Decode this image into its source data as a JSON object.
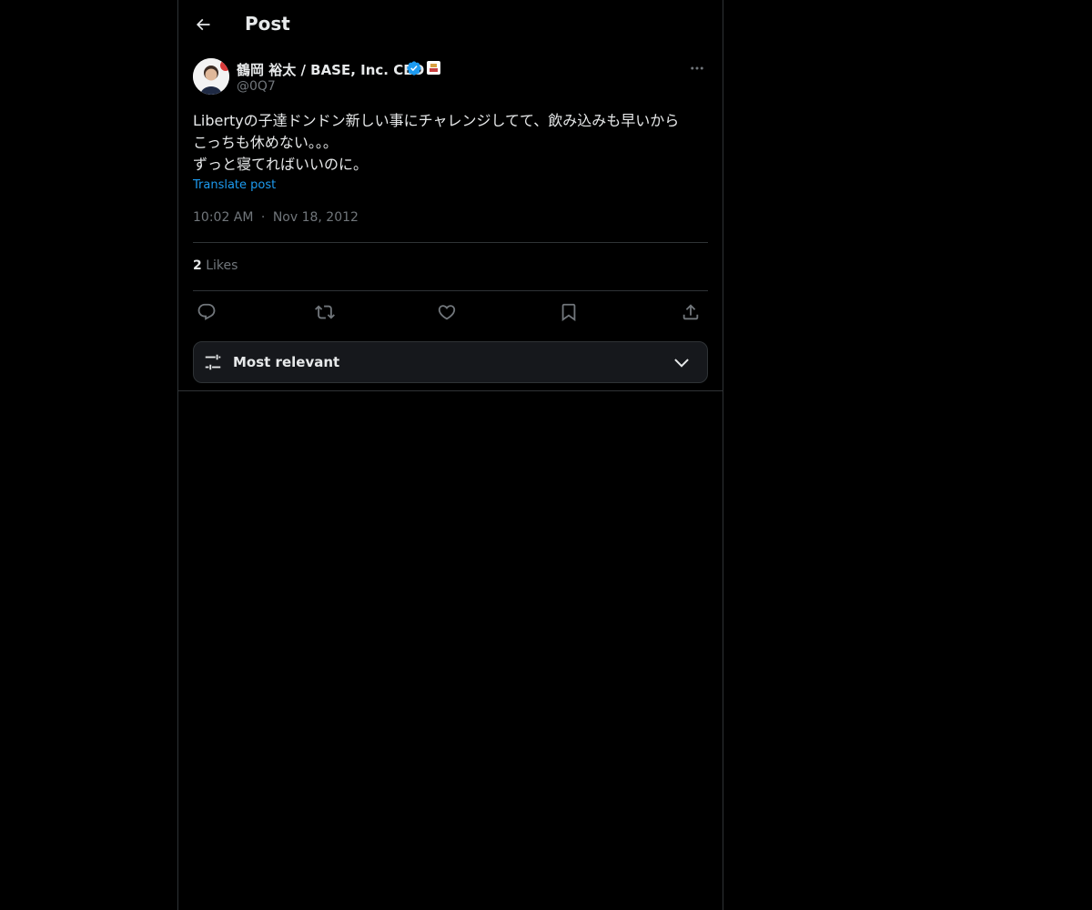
{
  "header": {
    "title": "Post",
    "back_icon": "arrow-left-icon"
  },
  "post": {
    "author": {
      "name": "鶴岡 裕太 / BASE, Inc. CEO",
      "handle": "@0Q7",
      "avatar_icon": "avatar",
      "verified_icon": "verified-badge-icon",
      "affiliate_icon": "affiliate-badge-icon"
    },
    "more_icon": "more-dots-icon",
    "text": "Libertyの子達ドンドン新しい事にチャレンジしてて、飲み込みも早いから\nこっちも休めない。。。\nずっと寝てればいいのに。",
    "translate_label": "Translate post",
    "time": "10:02 AM",
    "separator": "·",
    "date": "Nov 18, 2012",
    "likes": {
      "count": "2",
      "label": "Likes"
    },
    "actions": [
      {
        "name": "reply",
        "icon": "reply-icon"
      },
      {
        "name": "repost",
        "icon": "repost-icon"
      },
      {
        "name": "like",
        "icon": "heart-icon"
      },
      {
        "name": "bookmark",
        "icon": "bookmark-icon"
      },
      {
        "name": "share",
        "icon": "share-icon"
      }
    ]
  },
  "replies_sort": {
    "label": "Most relevant",
    "icon": "sliders-icon",
    "chevron": "chevron-down-icon"
  },
  "colors": {
    "background": "#000000",
    "text": "#e7e9ea",
    "muted": "#71767b",
    "accent": "#1d9bf0",
    "border": "#2f3336"
  }
}
